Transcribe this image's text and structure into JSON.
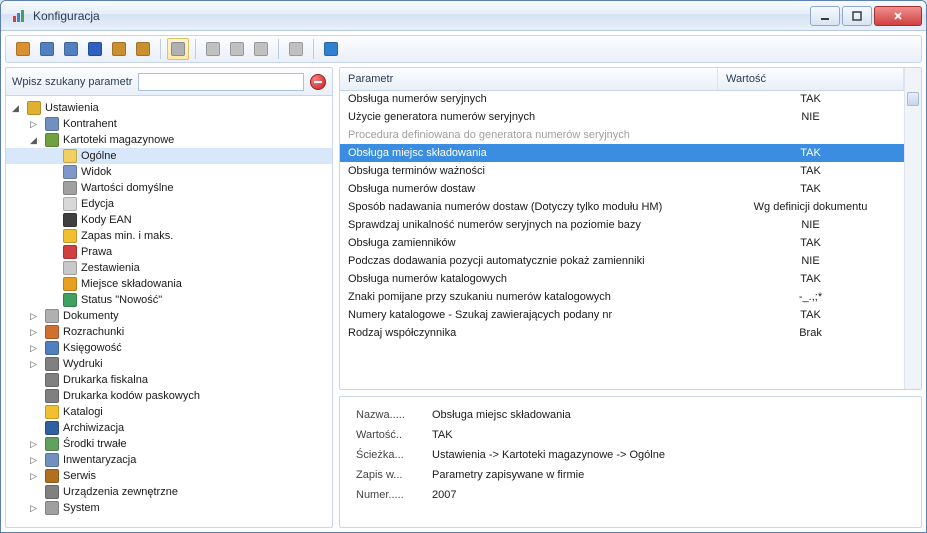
{
  "window": {
    "title": "Konfiguracja"
  },
  "search": {
    "label": "Wpisz szukany parametr",
    "value": ""
  },
  "tree": [
    {
      "depth": 0,
      "expand": "open",
      "icon": "settings-icon",
      "color": "#e0b030",
      "label": "Ustawienia",
      "name": "tree-ustawienia"
    },
    {
      "depth": 1,
      "expand": "closed",
      "icon": "person-icon",
      "color": "#7090c0",
      "label": "Kontrahent",
      "name": "tree-kontrahent"
    },
    {
      "depth": 1,
      "expand": "open",
      "icon": "warehouse-icon",
      "color": "#70a040",
      "label": "Kartoteki magazynowe",
      "name": "tree-kartoteki-magazynowe"
    },
    {
      "depth": 2,
      "expand": "none",
      "icon": "page-icon",
      "color": "#f0d060",
      "label": "Ogólne",
      "name": "tree-ogolne",
      "selected": true
    },
    {
      "depth": 2,
      "expand": "none",
      "icon": "view-icon",
      "color": "#8098c8",
      "label": "Widok",
      "name": "tree-widok"
    },
    {
      "depth": 2,
      "expand": "none",
      "icon": "defaults-icon",
      "color": "#a0a0a0",
      "label": "Wartości domyślne",
      "name": "tree-wartosci-domyslne"
    },
    {
      "depth": 2,
      "expand": "none",
      "icon": "edit-icon",
      "color": "#d8d8d8",
      "label": "Edycja",
      "name": "tree-edycja"
    },
    {
      "depth": 2,
      "expand": "none",
      "icon": "barcode-icon",
      "color": "#404040",
      "label": "Kody EAN",
      "name": "tree-kody-ean"
    },
    {
      "depth": 2,
      "expand": "none",
      "icon": "stock-icon",
      "color": "#f0c030",
      "label": "Zapas min. i maks.",
      "name": "tree-zapas"
    },
    {
      "depth": 2,
      "expand": "none",
      "icon": "rights-icon",
      "color": "#d04040",
      "label": "Prawa",
      "name": "tree-prawa"
    },
    {
      "depth": 2,
      "expand": "none",
      "icon": "list-icon",
      "color": "#c8c8c8",
      "label": "Zestawienia",
      "name": "tree-zestawienia"
    },
    {
      "depth": 2,
      "expand": "none",
      "icon": "storage-icon",
      "color": "#e8a020",
      "label": "Miejsce składowania",
      "name": "tree-miejsce-skladowania"
    },
    {
      "depth": 2,
      "expand": "none",
      "icon": "new-icon",
      "color": "#40a060",
      "label": "Status \"Nowość\"",
      "name": "tree-status-nowosc"
    },
    {
      "depth": 1,
      "expand": "closed",
      "icon": "documents-icon",
      "color": "#b0b0b0",
      "label": "Dokumenty",
      "name": "tree-dokumenty"
    },
    {
      "depth": 1,
      "expand": "closed",
      "icon": "settlements-icon",
      "color": "#d07030",
      "label": "Rozrachunki",
      "name": "tree-rozrachunki"
    },
    {
      "depth": 1,
      "expand": "closed",
      "icon": "accounting-icon",
      "color": "#5080c0",
      "label": "Księgowość",
      "name": "tree-ksiegowosc"
    },
    {
      "depth": 1,
      "expand": "closed",
      "icon": "print-icon",
      "color": "#808080",
      "label": "Wydruki",
      "name": "tree-wydruki"
    },
    {
      "depth": 1,
      "expand": "none",
      "icon": "fiscal-printer-icon",
      "color": "#808080",
      "label": "Drukarka fiskalna",
      "name": "tree-drukarka-fiskalna"
    },
    {
      "depth": 1,
      "expand": "none",
      "icon": "barcode-printer-icon",
      "color": "#808080",
      "label": "Drukarka kodów paskowych",
      "name": "tree-drukarka-kodow"
    },
    {
      "depth": 1,
      "expand": "none",
      "icon": "catalog-icon",
      "color": "#f0c030",
      "label": "Katalogi",
      "name": "tree-katalogi"
    },
    {
      "depth": 1,
      "expand": "none",
      "icon": "archive-icon",
      "color": "#3060a0",
      "label": "Archiwizacja",
      "name": "tree-archiwizacja"
    },
    {
      "depth": 1,
      "expand": "closed",
      "icon": "assets-icon",
      "color": "#60a060",
      "label": "Środki trwałe",
      "name": "tree-srodki-trwale"
    },
    {
      "depth": 1,
      "expand": "closed",
      "icon": "inventory-icon",
      "color": "#7090c0",
      "label": "Inwentaryzacja",
      "name": "tree-inwentaryzacja"
    },
    {
      "depth": 1,
      "expand": "closed",
      "icon": "service-icon",
      "color": "#b07020",
      "label": "Serwis",
      "name": "tree-serwis"
    },
    {
      "depth": 1,
      "expand": "none",
      "icon": "external-icon",
      "color": "#808080",
      "label": "Urządzenia zewnętrzne",
      "name": "tree-urzadzenia"
    },
    {
      "depth": 1,
      "expand": "closed",
      "icon": "system-icon",
      "color": "#a0a0a0",
      "label": "System",
      "name": "tree-system"
    }
  ],
  "grid": {
    "columns": {
      "param": "Parametr",
      "value": "Wartość"
    },
    "rows": [
      {
        "param": "Obsługa numerów seryjnych",
        "value": "TAK"
      },
      {
        "param": "Użycie generatora numerów seryjnych",
        "value": "NIE"
      },
      {
        "param": "Procedura definiowana do generatora numerów seryjnych",
        "value": "",
        "disabled": true
      },
      {
        "param": "Obsługa miejsc składowania",
        "value": "TAK",
        "selected": true
      },
      {
        "param": "Obsługa terminów ważności",
        "value": "TAK"
      },
      {
        "param": "Obsługa numerów dostaw",
        "value": "TAK"
      },
      {
        "param": "Sposób nadawania numerów dostaw (Dotyczy tylko modułu HM)",
        "value": "Wg definicji dokumentu"
      },
      {
        "param": "Sprawdzaj unikalność numerów seryjnych na poziomie bazy",
        "value": "NIE"
      },
      {
        "param": "Obsługa zamienników",
        "value": "TAK"
      },
      {
        "param": "Podczas dodawania pozycji automatycznie pokaż zamienniki",
        "value": "NIE"
      },
      {
        "param": "Obsługa numerów katalogowych",
        "value": "TAK"
      },
      {
        "param": "Znaki pomijane przy szukaniu numerów katalogowych",
        "value": "-_.,;*"
      },
      {
        "param": "Numery katalogowe - Szukaj zawierających podany nr",
        "value": "TAK"
      },
      {
        "param": "Rodzaj współczynnika",
        "value": "Brak"
      }
    ]
  },
  "details": {
    "labels": {
      "name": "Nazwa.....",
      "value": "Wartość..",
      "path": "Ścieżka...",
      "save": "Zapis w...",
      "number": "Numer....."
    },
    "values": {
      "name": "Obsługa miejsc składowania",
      "value": "TAK",
      "path": "Ustawienia -> Kartoteki magazynowe -> Ogólne",
      "save": "Parametry zapisywane w firmie",
      "number": "2007"
    }
  },
  "toolbar": {
    "buttons": [
      {
        "name": "home-icon",
        "color": "#d89030"
      },
      {
        "name": "server1-icon",
        "color": "#5080c0"
      },
      {
        "name": "server2-icon",
        "color": "#5080c0"
      },
      {
        "name": "star-icon",
        "color": "#3060c0"
      },
      {
        "name": "box1-icon",
        "color": "#c89030"
      },
      {
        "name": "box2-icon",
        "color": "#c89030"
      },
      {
        "name": "sep"
      },
      {
        "name": "tools-icon",
        "color": "#b0b0b0",
        "active": true
      },
      {
        "name": "sep"
      },
      {
        "name": "edit-icon",
        "color": "#c0c0c0"
      },
      {
        "name": "refresh-icon",
        "color": "#c0c0c0"
      },
      {
        "name": "undo-icon",
        "color": "#c0c0c0"
      },
      {
        "name": "sep"
      },
      {
        "name": "layout-icon",
        "color": "#c0c0c0"
      },
      {
        "name": "sep"
      },
      {
        "name": "help-icon",
        "color": "#3080d0"
      }
    ]
  }
}
